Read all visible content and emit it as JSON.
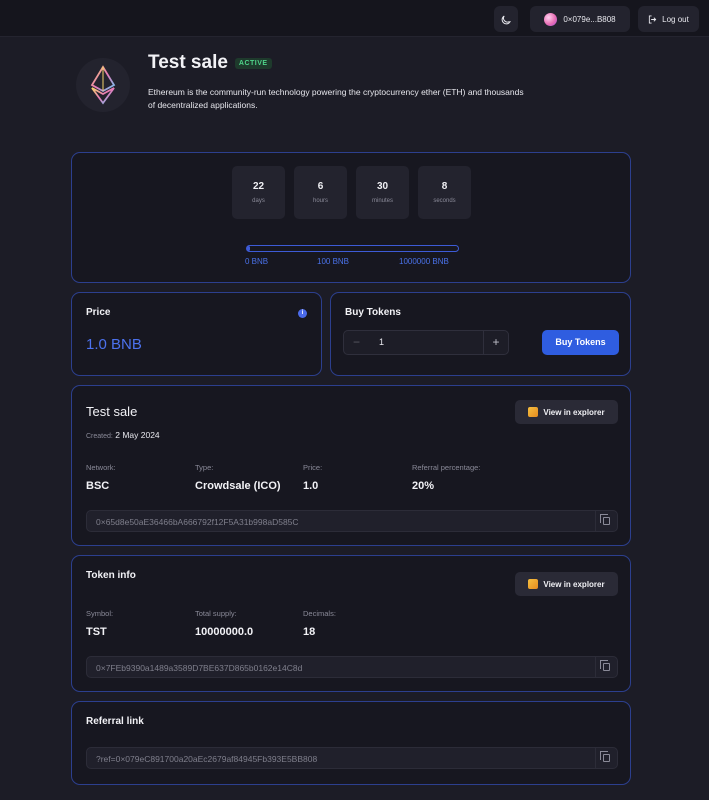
{
  "topbar": {
    "theme_icon": "moon-icon",
    "wallet_label": "0×079e...B808",
    "logout_label": "Log out"
  },
  "sale": {
    "title": "Test sale",
    "status": "ACTIVE",
    "description": "Ethereum is the community-run technology powering the cryptocurrency ether (ETH) and thousands of decentralized applications."
  },
  "countdown": {
    "days_value": "22",
    "days_label": "days",
    "hours_value": "6",
    "hours_label": "hours",
    "minutes_value": "30",
    "minutes_label": "minutes",
    "seconds_value": "8",
    "seconds_label": "seconds"
  },
  "progress": {
    "fraction": 0.0,
    "min_label": "0 BNB",
    "soft_label": "100 BNB",
    "max_label": "1000000 BNB"
  },
  "price": {
    "title": "Price",
    "value": "1.0 BNB",
    "info_icon": "info-icon"
  },
  "buy": {
    "title": "Buy Tokens",
    "minus": "−",
    "plus": "+",
    "quantity": "1",
    "button_label": "Buy Tokens"
  },
  "details": {
    "title": "Test sale",
    "created_label": "Created:",
    "created_value": "2 May 2024",
    "explorer_label": "View in explorer",
    "network_label": "Network:",
    "network_value": "BSC",
    "type_label": "Type:",
    "type_value": "Crowdsale (ICO)",
    "price_label": "Price:",
    "price_value": "1.0",
    "referral_label": "Referral percentage:",
    "referral_value": "20%",
    "address": "0×65d8e50aE36466bA666792f12F5A31b998aD585C"
  },
  "token": {
    "title": "Token info",
    "explorer_label": "View in explorer",
    "symbol_label": "Symbol:",
    "symbol_value": "TST",
    "supply_label": "Total supply:",
    "supply_value": "10000000.0",
    "decimals_label": "Decimals:",
    "decimals_value": "18",
    "address": "0×7FEb9390a1489a3589D7BE637D865b0162e14C8d"
  },
  "referral": {
    "title": "Referral link",
    "link": "?ref=0×079eC891700a20aEc2679af84945Fb393E5BB808"
  },
  "colors": {
    "accent": "#2f5de0",
    "card_border": "#2c3f8e",
    "active_badge": "#4fd48a"
  }
}
